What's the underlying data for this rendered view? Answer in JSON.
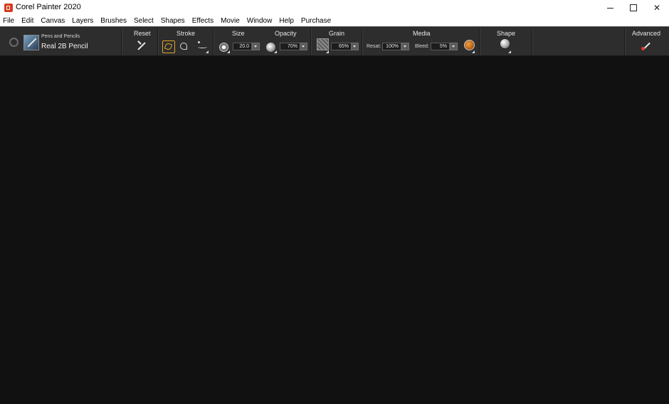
{
  "window": {
    "title": "Corel Painter 2020"
  },
  "menu": [
    "File",
    "Edit",
    "Canvas",
    "Layers",
    "Brushes",
    "Select",
    "Shapes",
    "Effects",
    "Movie",
    "Window",
    "Help",
    "Purchase"
  ],
  "property_bar": {
    "brush": {
      "category": "Pens and Pencils",
      "variant": "Real 2B Pencil"
    },
    "reset": {
      "label": "Reset"
    },
    "stroke": {
      "label": "Stroke"
    },
    "size": {
      "label": "Size",
      "value": "20.0"
    },
    "opacity": {
      "label": "Opacity",
      "value": "70%"
    },
    "grain": {
      "label": "Grain",
      "value": "65%"
    },
    "media": {
      "label": "Media",
      "resat_label": "Resat:",
      "resat_value": "100%",
      "bleed_label": "Bleed:",
      "bleed_value": "5%"
    },
    "shape": {
      "label": "Shape"
    },
    "advanced": {
      "label": "Advanced"
    }
  },
  "colors": {
    "property_bar_bg": "#2d2d2d",
    "workspace_bg": "#111111",
    "active_stroke_accent": "#e0a22a",
    "app_icon": "#d63b1f"
  }
}
